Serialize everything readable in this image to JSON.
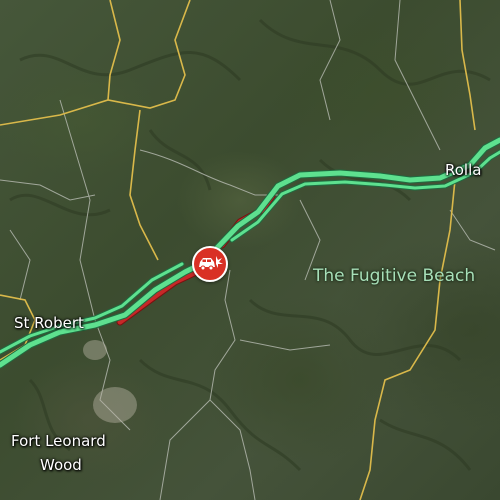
{
  "map": {
    "type": "satellite",
    "colors": {
      "traffic_free": "#5ee08f",
      "traffic_heavy": "#c62828",
      "incident": "#d93025",
      "road_minor": "#d9b84a"
    }
  },
  "places": {
    "rolla": "Rolla",
    "st_robert": "St Robert",
    "fort_leonard_wood_line1": "Fort Leonard",
    "fort_leonard_wood_line2": "Wood",
    "fugitive_beach": "The Fugitive Beach"
  },
  "incident": {
    "icon": "crash-car-icon",
    "kind": "crash"
  }
}
